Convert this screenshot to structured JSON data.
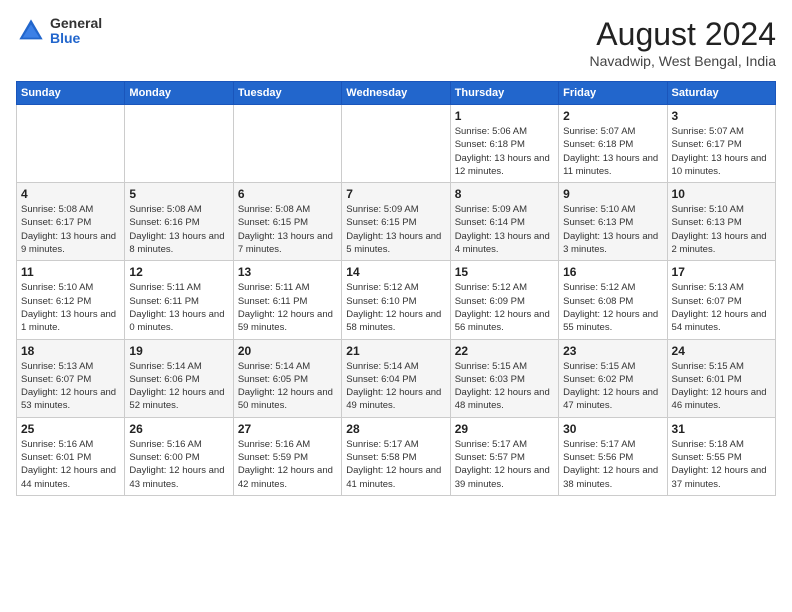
{
  "header": {
    "logo_general": "General",
    "logo_blue": "Blue",
    "title": "August 2024",
    "location": "Navadwip, West Bengal, India"
  },
  "weekdays": [
    "Sunday",
    "Monday",
    "Tuesday",
    "Wednesday",
    "Thursday",
    "Friday",
    "Saturday"
  ],
  "weeks": [
    [
      {
        "day": "",
        "sunrise": "",
        "sunset": "",
        "daylight": ""
      },
      {
        "day": "",
        "sunrise": "",
        "sunset": "",
        "daylight": ""
      },
      {
        "day": "",
        "sunrise": "",
        "sunset": "",
        "daylight": ""
      },
      {
        "day": "",
        "sunrise": "",
        "sunset": "",
        "daylight": ""
      },
      {
        "day": "1",
        "sunrise": "Sunrise: 5:06 AM",
        "sunset": "Sunset: 6:18 PM",
        "daylight": "Daylight: 13 hours and 12 minutes."
      },
      {
        "day": "2",
        "sunrise": "Sunrise: 5:07 AM",
        "sunset": "Sunset: 6:18 PM",
        "daylight": "Daylight: 13 hours and 11 minutes."
      },
      {
        "day": "3",
        "sunrise": "Sunrise: 5:07 AM",
        "sunset": "Sunset: 6:17 PM",
        "daylight": "Daylight: 13 hours and 10 minutes."
      }
    ],
    [
      {
        "day": "4",
        "sunrise": "Sunrise: 5:08 AM",
        "sunset": "Sunset: 6:17 PM",
        "daylight": "Daylight: 13 hours and 9 minutes."
      },
      {
        "day": "5",
        "sunrise": "Sunrise: 5:08 AM",
        "sunset": "Sunset: 6:16 PM",
        "daylight": "Daylight: 13 hours and 8 minutes."
      },
      {
        "day": "6",
        "sunrise": "Sunrise: 5:08 AM",
        "sunset": "Sunset: 6:15 PM",
        "daylight": "Daylight: 13 hours and 7 minutes."
      },
      {
        "day": "7",
        "sunrise": "Sunrise: 5:09 AM",
        "sunset": "Sunset: 6:15 PM",
        "daylight": "Daylight: 13 hours and 5 minutes."
      },
      {
        "day": "8",
        "sunrise": "Sunrise: 5:09 AM",
        "sunset": "Sunset: 6:14 PM",
        "daylight": "Daylight: 13 hours and 4 minutes."
      },
      {
        "day": "9",
        "sunrise": "Sunrise: 5:10 AM",
        "sunset": "Sunset: 6:13 PM",
        "daylight": "Daylight: 13 hours and 3 minutes."
      },
      {
        "day": "10",
        "sunrise": "Sunrise: 5:10 AM",
        "sunset": "Sunset: 6:13 PM",
        "daylight": "Daylight: 13 hours and 2 minutes."
      }
    ],
    [
      {
        "day": "11",
        "sunrise": "Sunrise: 5:10 AM",
        "sunset": "Sunset: 6:12 PM",
        "daylight": "Daylight: 13 hours and 1 minute."
      },
      {
        "day": "12",
        "sunrise": "Sunrise: 5:11 AM",
        "sunset": "Sunset: 6:11 PM",
        "daylight": "Daylight: 13 hours and 0 minutes."
      },
      {
        "day": "13",
        "sunrise": "Sunrise: 5:11 AM",
        "sunset": "Sunset: 6:11 PM",
        "daylight": "Daylight: 12 hours and 59 minutes."
      },
      {
        "day": "14",
        "sunrise": "Sunrise: 5:12 AM",
        "sunset": "Sunset: 6:10 PM",
        "daylight": "Daylight: 12 hours and 58 minutes."
      },
      {
        "day": "15",
        "sunrise": "Sunrise: 5:12 AM",
        "sunset": "Sunset: 6:09 PM",
        "daylight": "Daylight: 12 hours and 56 minutes."
      },
      {
        "day": "16",
        "sunrise": "Sunrise: 5:12 AM",
        "sunset": "Sunset: 6:08 PM",
        "daylight": "Daylight: 12 hours and 55 minutes."
      },
      {
        "day": "17",
        "sunrise": "Sunrise: 5:13 AM",
        "sunset": "Sunset: 6:07 PM",
        "daylight": "Daylight: 12 hours and 54 minutes."
      }
    ],
    [
      {
        "day": "18",
        "sunrise": "Sunrise: 5:13 AM",
        "sunset": "Sunset: 6:07 PM",
        "daylight": "Daylight: 12 hours and 53 minutes."
      },
      {
        "day": "19",
        "sunrise": "Sunrise: 5:14 AM",
        "sunset": "Sunset: 6:06 PM",
        "daylight": "Daylight: 12 hours and 52 minutes."
      },
      {
        "day": "20",
        "sunrise": "Sunrise: 5:14 AM",
        "sunset": "Sunset: 6:05 PM",
        "daylight": "Daylight: 12 hours and 50 minutes."
      },
      {
        "day": "21",
        "sunrise": "Sunrise: 5:14 AM",
        "sunset": "Sunset: 6:04 PM",
        "daylight": "Daylight: 12 hours and 49 minutes."
      },
      {
        "day": "22",
        "sunrise": "Sunrise: 5:15 AM",
        "sunset": "Sunset: 6:03 PM",
        "daylight": "Daylight: 12 hours and 48 minutes."
      },
      {
        "day": "23",
        "sunrise": "Sunrise: 5:15 AM",
        "sunset": "Sunset: 6:02 PM",
        "daylight": "Daylight: 12 hours and 47 minutes."
      },
      {
        "day": "24",
        "sunrise": "Sunrise: 5:15 AM",
        "sunset": "Sunset: 6:01 PM",
        "daylight": "Daylight: 12 hours and 46 minutes."
      }
    ],
    [
      {
        "day": "25",
        "sunrise": "Sunrise: 5:16 AM",
        "sunset": "Sunset: 6:01 PM",
        "daylight": "Daylight: 12 hours and 44 minutes."
      },
      {
        "day": "26",
        "sunrise": "Sunrise: 5:16 AM",
        "sunset": "Sunset: 6:00 PM",
        "daylight": "Daylight: 12 hours and 43 minutes."
      },
      {
        "day": "27",
        "sunrise": "Sunrise: 5:16 AM",
        "sunset": "Sunset: 5:59 PM",
        "daylight": "Daylight: 12 hours and 42 minutes."
      },
      {
        "day": "28",
        "sunrise": "Sunrise: 5:17 AM",
        "sunset": "Sunset: 5:58 PM",
        "daylight": "Daylight: 12 hours and 41 minutes."
      },
      {
        "day": "29",
        "sunrise": "Sunrise: 5:17 AM",
        "sunset": "Sunset: 5:57 PM",
        "daylight": "Daylight: 12 hours and 39 minutes."
      },
      {
        "day": "30",
        "sunrise": "Sunrise: 5:17 AM",
        "sunset": "Sunset: 5:56 PM",
        "daylight": "Daylight: 12 hours and 38 minutes."
      },
      {
        "day": "31",
        "sunrise": "Sunrise: 5:18 AM",
        "sunset": "Sunset: 5:55 PM",
        "daylight": "Daylight: 12 hours and 37 minutes."
      }
    ]
  ]
}
